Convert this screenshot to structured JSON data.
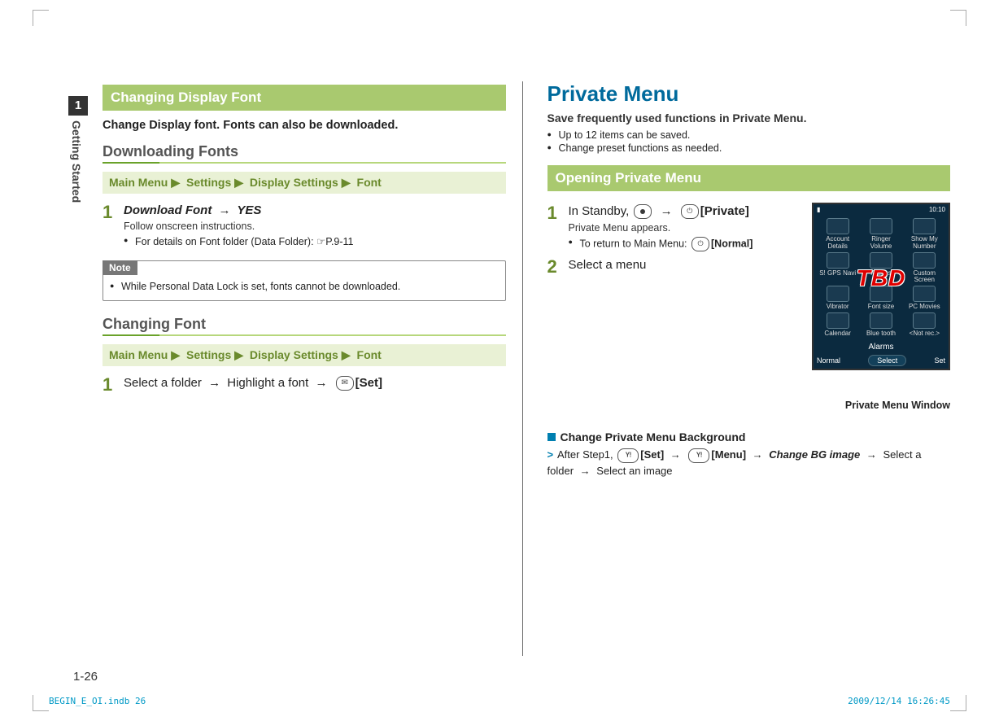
{
  "side": {
    "chapter_num": "1",
    "chapter_label": "Getting Started"
  },
  "left": {
    "banner": "Changing Display Font",
    "lead": "Change Display font. Fonts can also be downloaded.",
    "sec1_title": "Downloading Fonts",
    "path1": {
      "a": "Main Menu",
      "b": "Settings",
      "c": "Display Settings",
      "d": "Font"
    },
    "step1": {
      "num": "1",
      "title_a": "Download Font",
      "arrow": "→",
      "title_b": "YES",
      "body": "Follow onscreen instructions.",
      "bullet": "For details on Font folder (Data Folder): ☞P.9-11"
    },
    "note": {
      "tag": "Note",
      "body": "While Personal Data Lock is set, fonts cannot be downloaded."
    },
    "sec2_title": "Changing Font",
    "path2": {
      "a": "Main Menu",
      "b": "Settings",
      "c": "Display Settings",
      "d": "Font"
    },
    "step2": {
      "num": "1",
      "a": "Select a folder",
      "arrow1": "→",
      "b": "Highlight a font",
      "arrow2": "→",
      "btn_label": "[Set]"
    }
  },
  "right": {
    "title": "Private Menu",
    "sub": "Save frequently used functions in Private Menu.",
    "bullets": [
      "Up to 12 items can be saved.",
      "Change preset functions as needed."
    ],
    "banner": "Opening Private Menu",
    "step1": {
      "num": "1",
      "a": "In Standby,",
      "arrow": "→",
      "btn_label": "[Private]",
      "body": "Private Menu appears.",
      "bullet_a": "To return to Main Menu:",
      "bullet_btn": "[Normal]"
    },
    "step2": {
      "num": "2",
      "a": "Select a menu"
    },
    "shot": {
      "time": "10:10",
      "antenna": "▮",
      "cells": [
        "Account Details",
        "Ringer Volume",
        "Show My Number",
        "S! GPS Navi",
        "Alarms",
        "Custom Screen",
        "Vibrator",
        "Font size",
        "PC Movies",
        "Calendar",
        "Blue tooth",
        "<Not rec.>"
      ],
      "alarm_row": "Alarms",
      "left_soft": "Normal",
      "center_soft": "Select",
      "right_soft": "Set",
      "tbd": "TBD",
      "caption": "Private Menu Window"
    },
    "change_bg": {
      "title": "Change Private Menu Background",
      "gt": ">",
      "a": "After Step1,",
      "set": "[Set]",
      "arrow1": "→",
      "menu": "[Menu]",
      "arrow2": "→",
      "ital": "Change BG image",
      "arrow3": "→",
      "b": "Select a folder",
      "arrow4": "→",
      "c": "Select an image"
    }
  },
  "footer": {
    "page_num": "1-26",
    "left": "BEGIN_E_OI.indb   26",
    "right": "2009/12/14   16:26:45"
  }
}
